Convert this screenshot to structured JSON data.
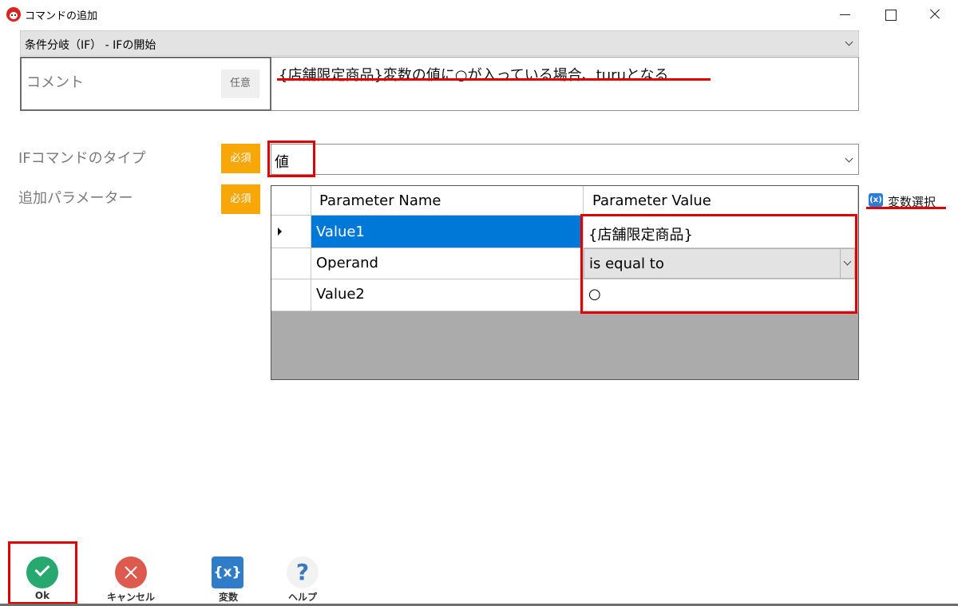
{
  "window": {
    "title": "コマンドの追加"
  },
  "command_select": {
    "value": "条件分岐（IF） - IFの開始"
  },
  "comment": {
    "label": "コメント",
    "badge": "任意",
    "value": "{店舗限定商品}変数の値に○が入っている場合、turuとなる"
  },
  "if_type": {
    "label": "IFコマンドのタイプ",
    "badge": "必須",
    "value": "値"
  },
  "params": {
    "label": "追加パラメーター",
    "badge": "必須",
    "header_name": "Parameter Name",
    "header_value": "Parameter Value",
    "rows": [
      {
        "name": "Value1",
        "value": "{店舗限定商品}"
      },
      {
        "name": "Operand",
        "value": "is equal to"
      },
      {
        "name": "Value2",
        "value": "○"
      }
    ]
  },
  "variable_link": {
    "icon": "(x)",
    "label": "変数選択"
  },
  "toolbar": {
    "ok_label": "Ok",
    "cancel_label": "キャンセル",
    "variables_icon": "{x}",
    "variables_label": "変数",
    "help_icon": "?",
    "help_label": "ヘルプ"
  },
  "colors": {
    "highlight": "#e00000",
    "required_badge": "#f7a707",
    "selection": "#0078d7",
    "ok_button": "#27a86f",
    "cancel_button": "#dc5b4e"
  }
}
